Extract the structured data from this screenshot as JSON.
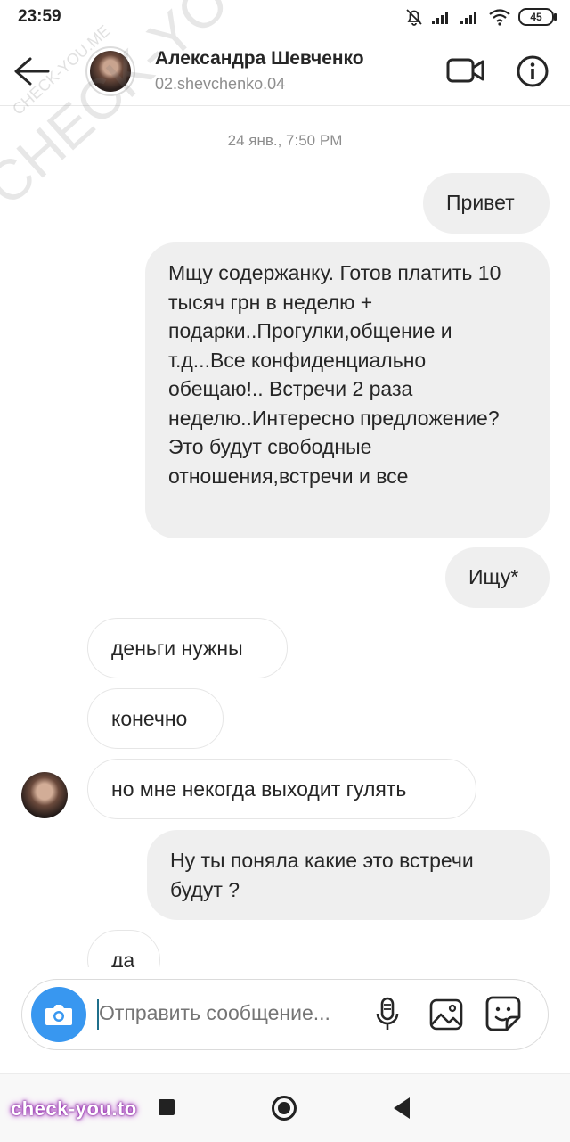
{
  "status_bar": {
    "time": "23:59",
    "battery": "45"
  },
  "header": {
    "name": "Александра Шевченко",
    "handle": "02.shevchenko.04"
  },
  "chat": {
    "date": "24 янв., 7:50 PM",
    "messages": [
      {
        "direction": "out",
        "text": "Привет"
      },
      {
        "direction": "out",
        "text": "Мщу содержанку. Готов платить 10 тысяч грн в неделю + подарки..Прогулки,общение и т.д...Все конфиденциально обещаю!.. Встречи 2 раза неделю..Интересно предложение? Это будут свободные отношения,встречи и все"
      },
      {
        "direction": "out",
        "text": "Ищу*"
      },
      {
        "direction": "in",
        "text": "деньги нужны"
      },
      {
        "direction": "in",
        "text": "конечно"
      },
      {
        "direction": "in",
        "text": "но мне некогда выходит гулять"
      },
      {
        "direction": "out",
        "text": "Ну ты поняла какие это встречи будут ?"
      },
      {
        "direction": "in",
        "text": "да"
      }
    ]
  },
  "composer": {
    "placeholder": "Отправить сообщение..."
  },
  "watermarks": {
    "diagonal": "CHECK-YOU.ME",
    "small": "CHECK-YOU.ME",
    "brand": "check-you.to"
  },
  "colors": {
    "accent": "#3897f0",
    "bubble_out": "#efefef",
    "bubble_in_border": "#e6e6e6"
  }
}
